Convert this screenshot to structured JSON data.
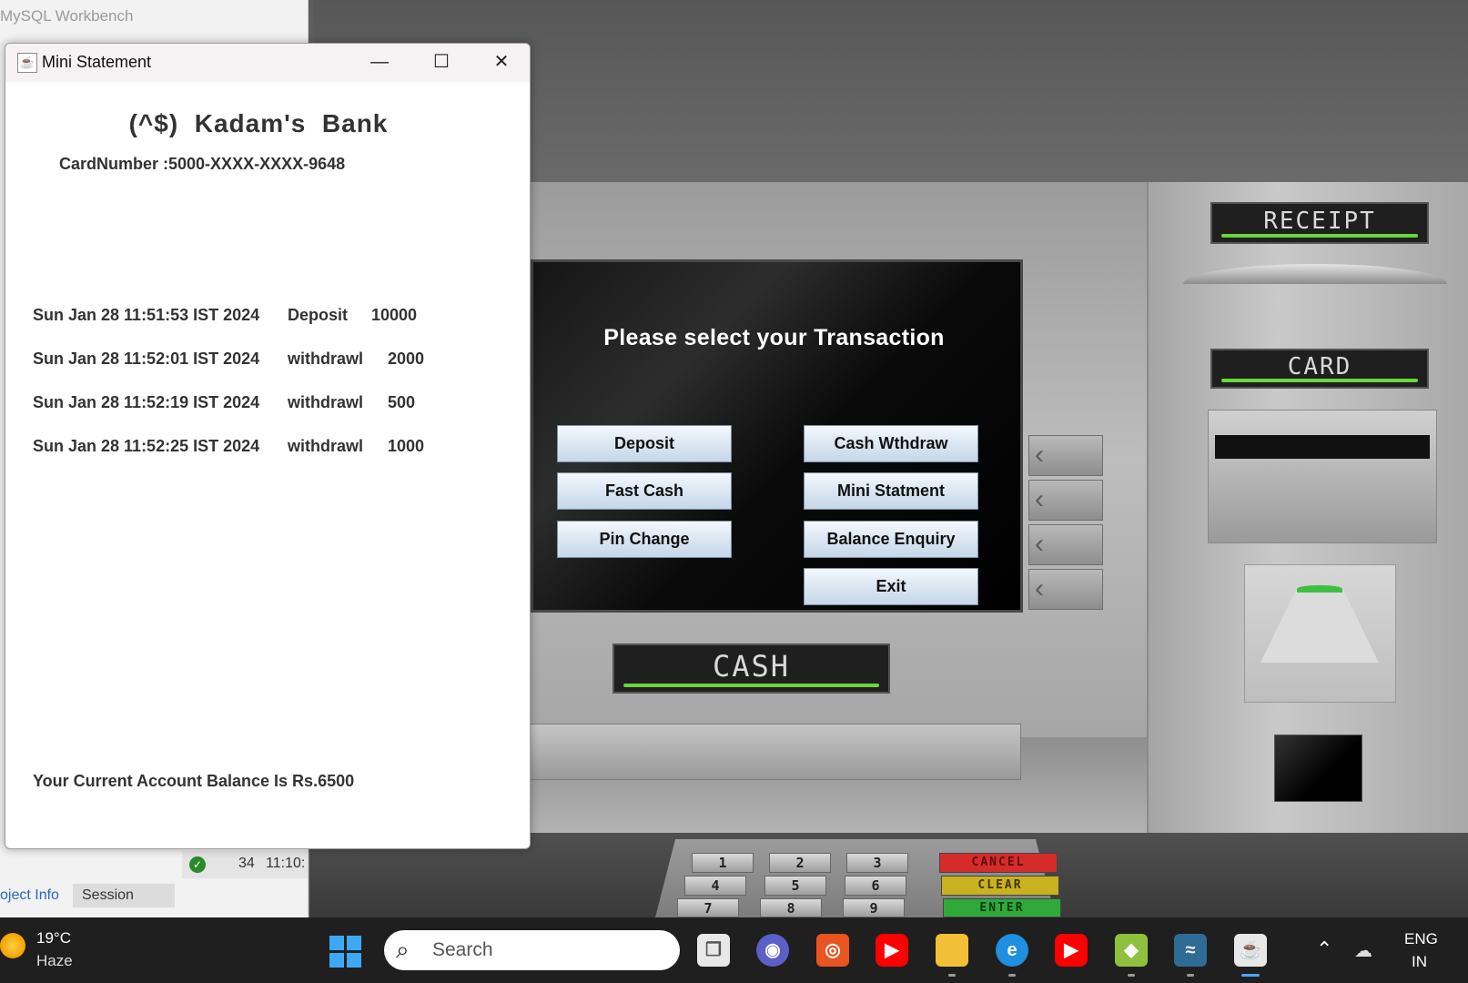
{
  "background_app": {
    "title": "MySQL Workbench",
    "log_row": {
      "number": "34",
      "time": "11:10:"
    },
    "tabs": [
      "oject Info",
      "Session"
    ]
  },
  "atm": {
    "screen_title": "Please select your Transaction",
    "buttons": {
      "deposit": "Deposit",
      "cash_withdraw": "Cash Wthdraw",
      "fast_cash": "Fast Cash",
      "mini_statement": "Mini Statment",
      "pin_change": "Pin Change",
      "balance_enquiry": "Balance Enquiry",
      "exit": "Exit"
    },
    "labels": {
      "receipt": "RECEIPT",
      "card": "CARD",
      "cash": "CASH"
    },
    "keypad": {
      "keys": [
        "1",
        "2",
        "3",
        "4",
        "5",
        "6",
        "7",
        "8",
        "9"
      ],
      "cancel": "CANCEL",
      "clear": "CLEAR",
      "enter": "ENTER"
    },
    "colors": {
      "label_bar": "#6bd63b",
      "button_bg": "#d8e5f2",
      "cancel": "#d62b2b",
      "clear": "#c9b21f",
      "enter": "#2faa3a"
    }
  },
  "mini_statement": {
    "window_title": "Mini Statement",
    "window_controls": {
      "minimize": "—",
      "maximize": "☐",
      "close": "✕"
    },
    "bank_name": "(^$)  Kadam's  Bank",
    "card_number": "CardNumber :5000-XXXX-XXXX-9648",
    "transactions": [
      {
        "date": "Sun Jan 28 11:51:53 IST 2024",
        "type": "Deposit",
        "amount": "10000"
      },
      {
        "date": "Sun Jan 28 11:52:01 IST 2024",
        "type": "withdrawl",
        "amount": "2000"
      },
      {
        "date": "Sun Jan 28 11:52:19 IST 2024",
        "type": "withdrawl",
        "amount": "500"
      },
      {
        "date": "Sun Jan 28 11:52:25 IST 2024",
        "type": "withdrawl",
        "amount": "1000"
      }
    ],
    "balance": "Your Current Account Balance Is Rs.6500"
  },
  "taskbar": {
    "weather": {
      "temp": "19°C",
      "desc": "Haze"
    },
    "search_placeholder": "Search",
    "tray": {
      "lang": "ENG",
      "region": "IN"
    }
  }
}
